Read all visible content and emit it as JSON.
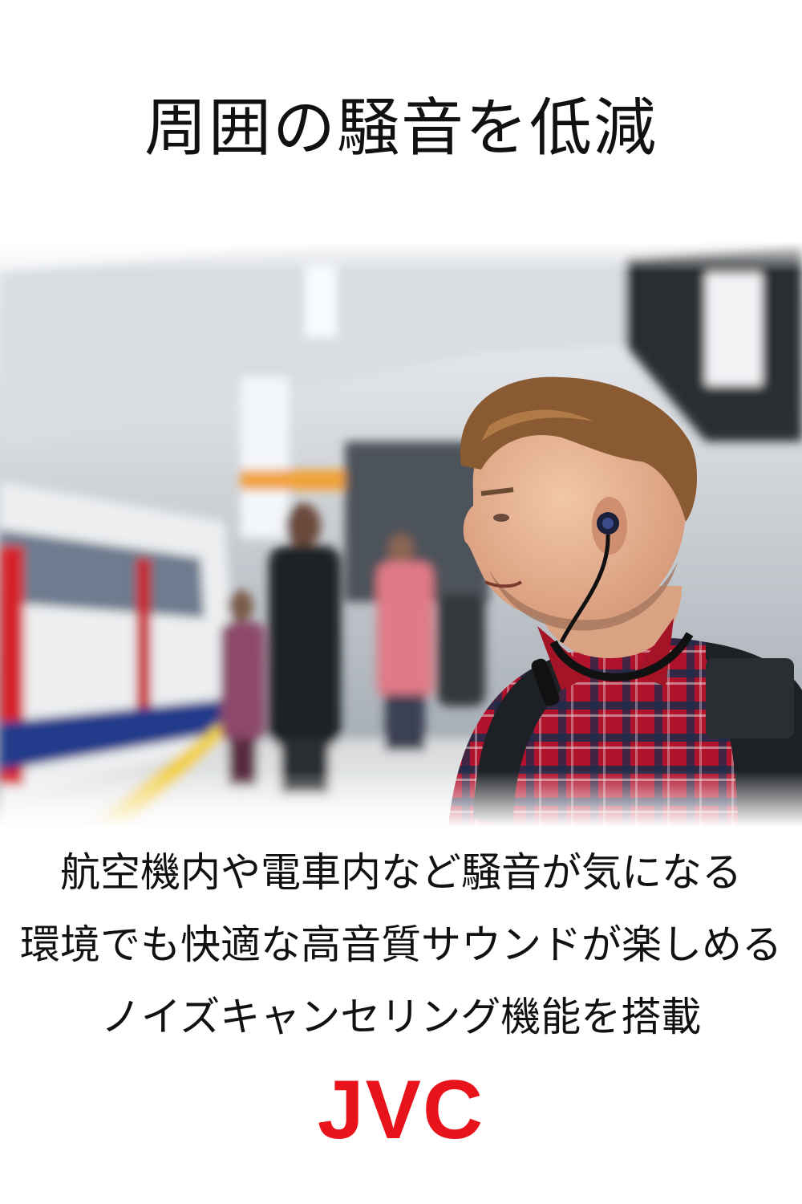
{
  "headline": "周囲の騒音を低減",
  "description": {
    "lines": [
      "航空機内や電車内など騒音が気になる",
      "環境でも快適な高音質サウンドが楽しめる",
      "ノイズキャンセリング機能を搭載"
    ]
  },
  "brand": {
    "logo_text": "JVC",
    "logo_color": "#e8131b"
  },
  "photo": {
    "subject_icon": "man-with-earphones-photo"
  }
}
